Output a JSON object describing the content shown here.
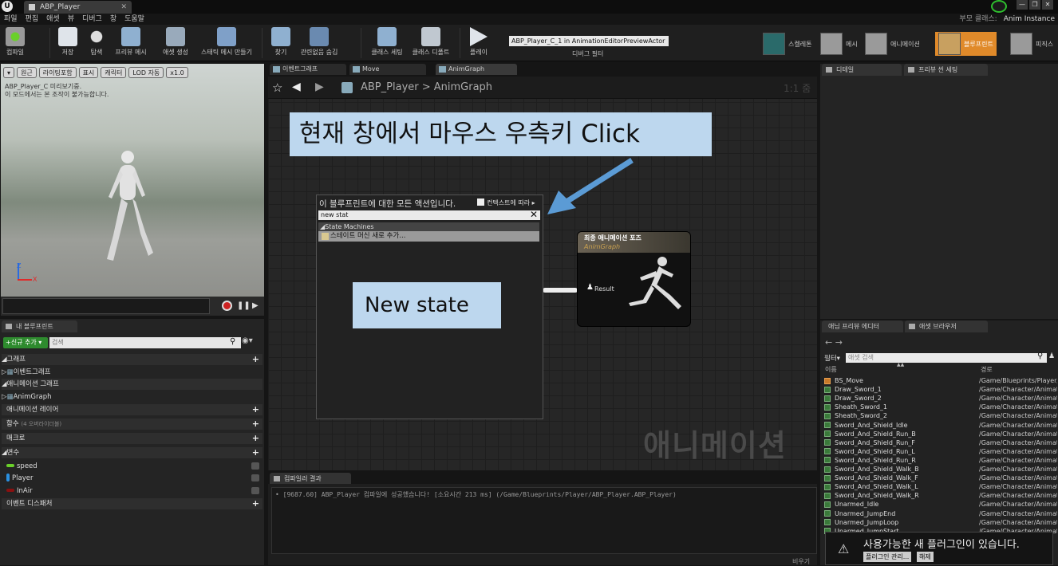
{
  "app": {
    "doc_tab": "ABP_Player",
    "logo": "U",
    "parent_class_label": "부모 클래스:",
    "parent_class_value": "Anim Instance"
  },
  "menu": [
    "파일",
    "편집",
    "애셋",
    "뷰",
    "디버그",
    "창",
    "도움말"
  ],
  "toolbar": {
    "compile": "컴파일",
    "save": "저장",
    "browse": "탐색",
    "preview_mesh": "프리뷰 메시",
    "asset_create": "애셋 생성",
    "static_mesh": "스태틱 메시 만들기",
    "find": "찾기",
    "hide_unrelated": "관련없음 숨김",
    "class_settings": "클래스 세팅",
    "class_defaults": "클래스 디폴트",
    "play": "플레이",
    "debug_object": "ABP_Player_C_1 in AnimationEditorPreviewActor",
    "debug_filter": "디버그 필터"
  },
  "modes": {
    "skeleton": "스켈레톤",
    "mesh": "메시",
    "animation": "애니메이션",
    "blueprint": "블루프린트",
    "physics": "피직스"
  },
  "viewport": {
    "perspective": "원근",
    "lighting": "라이팅포함",
    "show": "표시",
    "character": "캐릭터",
    "lod": "LOD 자동",
    "speed": "x1.0",
    "info": "ABP_Player_C 미리보기중.\n이 모드에서는 본 조작이 불가능합니다.",
    "axis_z": "Z",
    "axis_x": "X"
  },
  "my_blueprint": {
    "tab": "내 블루프린트",
    "add_new": "신규 추가",
    "search_placeholder": "검색",
    "graphs": "그래프",
    "event_graph": "이벤트그래프",
    "anim_graphs": "애니메이션 그래프",
    "anim_graph": "AnimGraph",
    "anim_layers": "애니메이션 레이어",
    "functions": "함수",
    "functions_note": "(4 오버라이더블)",
    "macros": "매크로",
    "variables": "변수",
    "vars": [
      {
        "name": "speed",
        "color": "#6ad02a"
      },
      {
        "name": "Player",
        "color": "#2a90e0"
      },
      {
        "name": "InAir",
        "color": "#8a1010"
      }
    ],
    "dispatchers": "이벤트 디스패처"
  },
  "graph": {
    "tabs": [
      "이벤트그래프",
      "Move",
      "AnimGraph"
    ],
    "breadcrumb": "ABP_Player  >  AnimGraph",
    "zoom": "1:1 줌",
    "watermark": "애니메이션"
  },
  "annotations": {
    "top": "현재 창에서 마우스 우측키 Click",
    "state": "New state"
  },
  "context_menu": {
    "title": "이 블루프린트에 대한 모든 액션입니다.",
    "context_label": "컨텍스트에 따라",
    "search_value": "new stat",
    "category": "State Machines",
    "item": "스테이트 머신 새로 추가..."
  },
  "final_node": {
    "title": "최종 애니메이션 포즈",
    "subtitle": "AnimGraph",
    "pin": "Result"
  },
  "compiler": {
    "tab": "컴파일러 결과",
    "log": "• [9687.60] ABP_Player 컴파일에 성공했습니다! [소요시간 213 ms] (/Game/Blueprints/Player/ABP_Player.ABP_Player)",
    "footer": "비우기"
  },
  "right": {
    "details_tab": "디테일",
    "preview_tab": "프리뷰 씬 세팅",
    "anim_preview_tab": "애님 프리뷰 에디터",
    "asset_tab": "애셋 브라우저",
    "filter": "필터",
    "asset_search_placeholder": "애셋 검색",
    "col_name": "이름",
    "col_path": "경로"
  },
  "assets": [
    {
      "name": "BS_Move",
      "path": "/Game/Blueprints/Player/",
      "type": "bs"
    },
    {
      "name": "Draw_Sword_1",
      "path": "/Game/Character/Animat",
      "type": "anim"
    },
    {
      "name": "Draw_Sword_2",
      "path": "/Game/Character/Animat",
      "type": "anim"
    },
    {
      "name": "Sheath_Sword_1",
      "path": "/Game/Character/Animat",
      "type": "anim"
    },
    {
      "name": "Sheath_Sword_2",
      "path": "/Game/Character/Animat",
      "type": "anim"
    },
    {
      "name": "Sword_And_Shield_Idle",
      "path": "/Game/Character/Animat",
      "type": "anim"
    },
    {
      "name": "Sword_And_Shield_Run_B",
      "path": "/Game/Character/Animat",
      "type": "anim"
    },
    {
      "name": "Sword_And_Shield_Run_F",
      "path": "/Game/Character/Animat",
      "type": "anim"
    },
    {
      "name": "Sword_And_Shield_Run_L",
      "path": "/Game/Character/Animat",
      "type": "anim"
    },
    {
      "name": "Sword_And_Shield_Run_R",
      "path": "/Game/Character/Animat",
      "type": "anim"
    },
    {
      "name": "Sword_And_Shield_Walk_B",
      "path": "/Game/Character/Animat",
      "type": "anim"
    },
    {
      "name": "Sword_And_Shield_Walk_F",
      "path": "/Game/Character/Animat",
      "type": "anim"
    },
    {
      "name": "Sword_And_Shield_Walk_L",
      "path": "/Game/Character/Animat",
      "type": "anim"
    },
    {
      "name": "Sword_And_Shield_Walk_R",
      "path": "/Game/Character/Animat",
      "type": "anim"
    },
    {
      "name": "Unarmed_Idle",
      "path": "/Game/Character/Animat",
      "type": "anim"
    },
    {
      "name": "Unarmed_JumpEnd",
      "path": "/Game/Character/Animat",
      "type": "anim"
    },
    {
      "name": "Unarmed_JumpLoop",
      "path": "/Game/Character/Animat",
      "type": "anim"
    },
    {
      "name": "Unarmed_JumpStart",
      "path": "/Game/Character/Animat",
      "type": "anim"
    }
  ],
  "plugin_toast": {
    "message": "사용가능한 새 플러그인이 있습니다.",
    "manage": "플러그인 관리...",
    "dismiss": "해제"
  }
}
